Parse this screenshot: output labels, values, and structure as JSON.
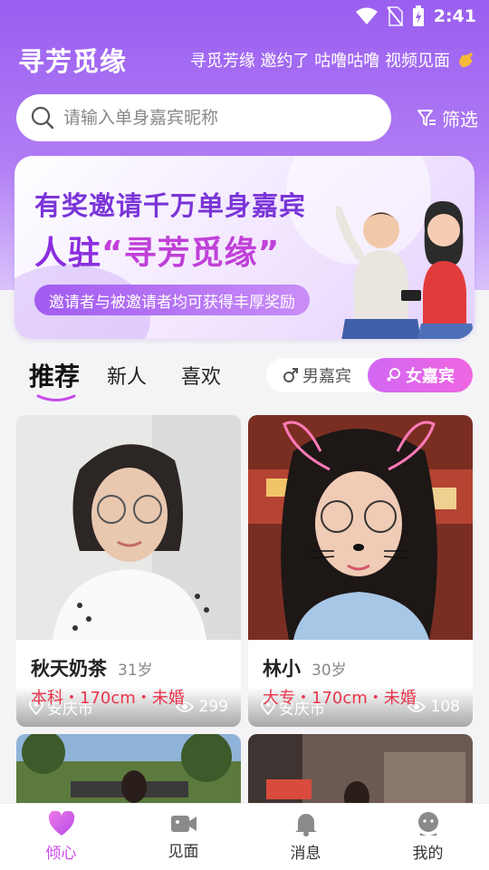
{
  "status_bar": {
    "time": "2:41"
  },
  "header": {
    "title": "寻芳觅缘",
    "marquee": "寻觅芳缘 邀约了 咕噜咕噜 视频见面"
  },
  "search": {
    "placeholder": "请输入单身嘉宾昵称",
    "filter_label": "筛选"
  },
  "banner": {
    "line1": "有奖邀请千万单身嘉宾",
    "line2_prefix": "人驻",
    "line2_highlight": "“寻芳觅缘”",
    "subtitle": "邀请者与被邀请者均可获得丰厚奖励"
  },
  "tabs": [
    {
      "label": "推荐",
      "active": true
    },
    {
      "label": "新人",
      "active": false
    },
    {
      "label": "喜欢",
      "active": false
    }
  ],
  "gender_filter": {
    "male": "男嘉宾",
    "female": "女嘉宾",
    "selected": "female"
  },
  "cards": [
    {
      "name": "秋天奶茶",
      "age": "31岁",
      "info": "本科・170cm・未婚",
      "location": "安庆市",
      "views": "299"
    },
    {
      "name": "林小",
      "age": "30岁",
      "info": "大专・170cm・未婚",
      "location": "安庆市",
      "views": "108"
    }
  ],
  "bottom_nav": [
    {
      "label": "倾心",
      "icon": "heart-icon",
      "active": true
    },
    {
      "label": "见面",
      "icon": "video-icon",
      "active": false
    },
    {
      "label": "消息",
      "icon": "bell-icon",
      "active": false
    },
    {
      "label": "我的",
      "icon": "profile-icon",
      "active": false
    }
  ],
  "colors": {
    "brand_purple": "#9a5ef0",
    "accent_pink": "#c94be8",
    "info_red": "#e8354b"
  }
}
